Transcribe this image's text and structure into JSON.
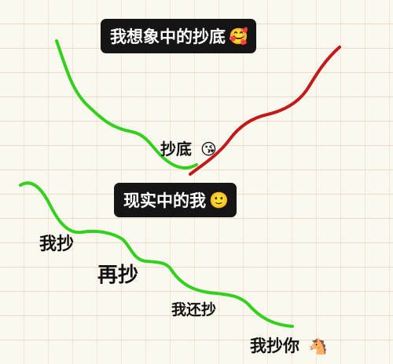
{
  "top_caption": {
    "text": "我想象中的抄底",
    "emoji": "🥰"
  },
  "bottom_caption": {
    "text": "现实中的我",
    "emoji": "🙂"
  },
  "imagined_bottom_label": {
    "text": "抄底",
    "emoji": "😘"
  },
  "reality_labels": [
    {
      "text": "我抄",
      "emoji": ""
    },
    {
      "text": "再抄",
      "emoji": ""
    },
    {
      "text": "我还抄",
      "emoji": ""
    },
    {
      "text": "我抄你",
      "emoji": "🐴"
    }
  ],
  "colors": {
    "falling_line": "#33d11e",
    "rising_line": "#c21a1a",
    "caption_background": "#151515",
    "paper": "#fbf8ef",
    "grid_lines": "#e9dcc8"
  }
}
